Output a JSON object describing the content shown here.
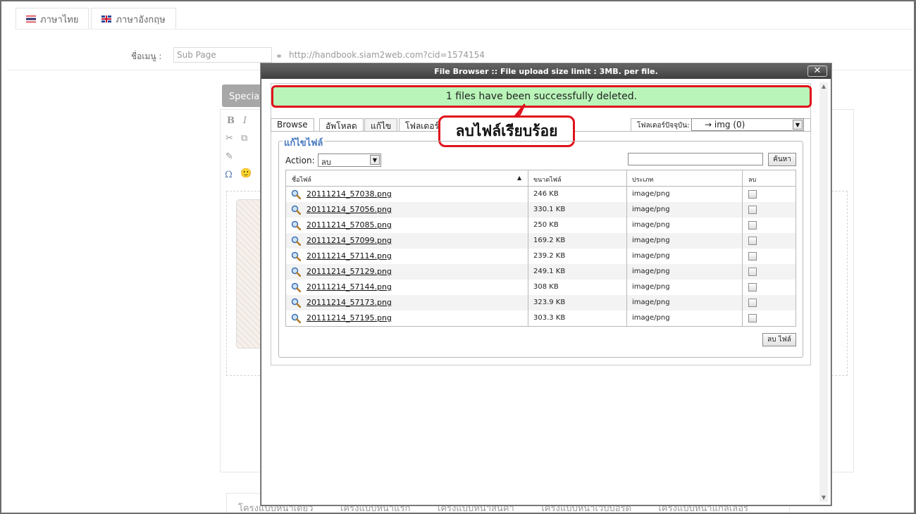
{
  "background": {
    "lang_tabs": [
      {
        "label": "ภาษาไทย",
        "flag": "thai-flag-icon"
      },
      {
        "label": "ภาษาอังกฤษ",
        "flag": "uk-flag-icon"
      }
    ],
    "menu_label": "ชื่อเมนู :",
    "menu_value": "Sub Page",
    "menu_url": "http://handbook.siam2web.com?cid=1574154",
    "special_tab": "Special",
    "toolbar": {
      "bold": "B",
      "italic": "I",
      "omega": "Ω",
      "smiley": "🙂"
    },
    "bottom_tabs": [
      "โครงแบบหน้าเดียว",
      "โครงแบบหน้าแรก",
      "โครงแบบหน้าสินค้า",
      "โครงแบบหน้าเว็บบอร์ด",
      "โครงแบบหน้าแกลเลอรี่"
    ]
  },
  "modal": {
    "title": "File Browser :: File upload size limit : 3MB. per file.",
    "close": "✕",
    "success_message": "1 files have been successfully deleted.",
    "callout": "ลบไฟล์เรียบร้อย",
    "tabs": [
      "Browse",
      "อัพโหลด",
      "แก้ไข",
      "โฟลเดอร์"
    ],
    "active_tab": "แก้ไข",
    "current_folder_label": "โฟลเดอร์ปัจจุบัน:",
    "current_folder_value": "→ img (0)",
    "legend": "แก้ไขไฟล์",
    "action_label": "Action:",
    "action_value": "ลบ",
    "search_button": "ค้นหา",
    "search_value": "",
    "columns": {
      "name": "ชื่อไฟล์",
      "size": "ขนาดไฟล์",
      "type": "ประเภท",
      "delete": "ลบ"
    },
    "files": [
      {
        "name": "20111214_57038.png",
        "size": "246 KB",
        "type": "image/png"
      },
      {
        "name": "20111214_57056.png",
        "size": "330.1 KB",
        "type": "image/png"
      },
      {
        "name": "20111214_57085.png",
        "size": "250 KB",
        "type": "image/png"
      },
      {
        "name": "20111214_57099.png",
        "size": "169.2 KB",
        "type": "image/png"
      },
      {
        "name": "20111214_57114.png",
        "size": "239.2 KB",
        "type": "image/png"
      },
      {
        "name": "20111214_57129.png",
        "size": "249.1 KB",
        "type": "image/png"
      },
      {
        "name": "20111214_57144.png",
        "size": "308 KB",
        "type": "image/png"
      },
      {
        "name": "20111214_57173.png",
        "size": "323.9 KB",
        "type": "image/png"
      },
      {
        "name": "20111214_57195.png",
        "size": "303.3 KB",
        "type": "image/png"
      }
    ],
    "delete_button": "ลบ ไฟล์",
    "colors": {
      "success_bg": "#b9f5b9",
      "highlight": "#e0121b",
      "legend": "#4a7bc0"
    }
  }
}
